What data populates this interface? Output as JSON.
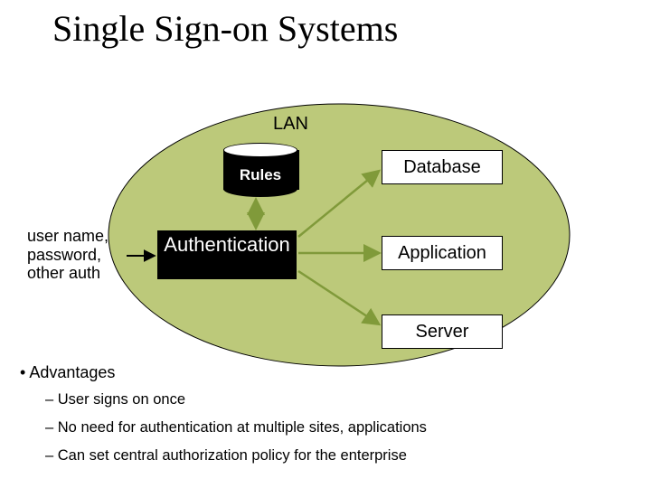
{
  "title": "Single Sign-on Systems",
  "diagram": {
    "zone": "LAN",
    "rules": "Rules",
    "auth": "Authentication",
    "nodes": {
      "database": "Database",
      "application": "Application",
      "server": "Server"
    },
    "inputs": [
      "user name,",
      "password,",
      "other auth"
    ]
  },
  "bullets": {
    "heading": "Advantages",
    "items": [
      "User signs on once",
      "No need for authentication at multiple sites, applications",
      "Can set central authorization policy for the enterprise"
    ]
  }
}
